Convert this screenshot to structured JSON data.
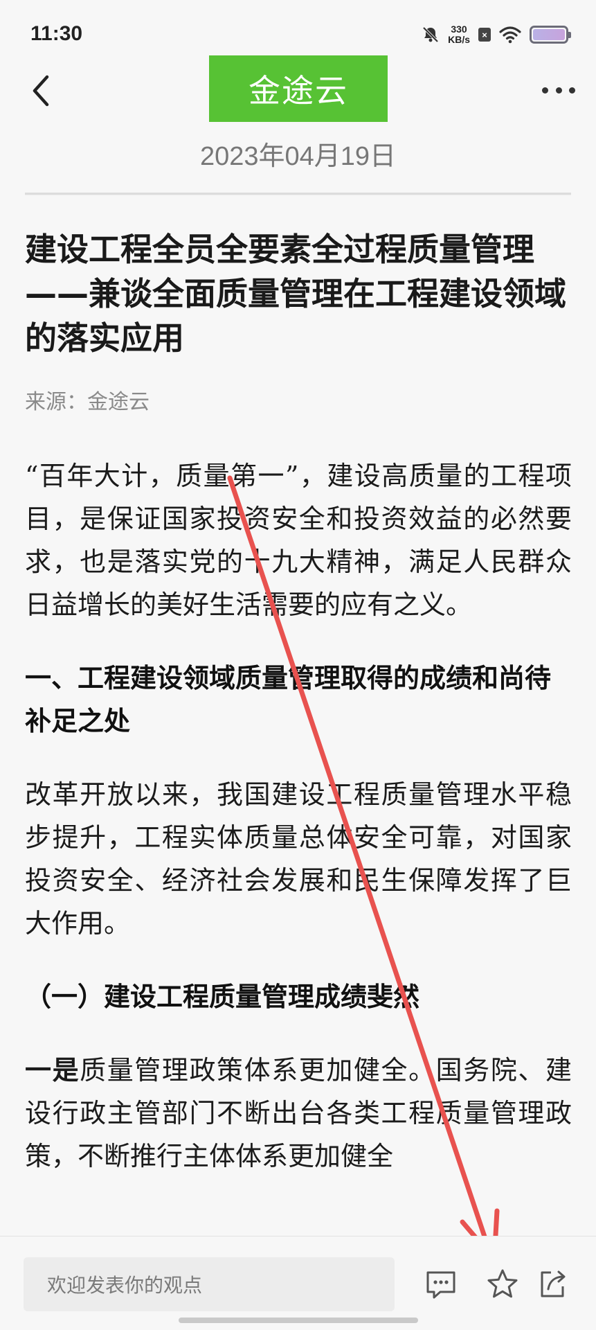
{
  "status_bar": {
    "time": "11:30",
    "net_speed_value": "330",
    "net_speed_unit": "KB/s",
    "icons": [
      "mute-bell-icon",
      "sim-x-icon",
      "wifi-icon",
      "battery-icon"
    ]
  },
  "header": {
    "logo_text": "金途云",
    "date": "2023年04月19日",
    "back_icon": "chevron-left-icon",
    "more_icon": "more-dots-icon"
  },
  "article": {
    "title": "建设工程全员全要素全过程质量管理——兼谈全面质量管理在工程建设领域的落实应用",
    "source": "来源：金途云",
    "intro": "“百年大计，质量第一”，建设高质量的工程项目，是保证国家投资安全和投资效益的必然要求，也是落实党的十九大精神，满足人民群众日益增长的美好生活需要的应有之义。",
    "heading1": "一、工程建设领域质量管理取得的成绩和尚待补足之处",
    "para2": "改革开放以来，我国建设工程质量管理水平稳步提升，工程实体质量总体安全可靠，对国家投资安全、经济社会发展和民生保障发挥了巨大作用。",
    "heading2": "（一）建设工程质量管理成绩斐然",
    "para3_lead": "一是",
    "para3_rest": "质量管理政策体系更加健全。国务院、建设行政主管部门不断出台各类工程质量管理政策，不断推行主体体系更加健全"
  },
  "bottom_bar": {
    "comment_placeholder": "欢迎发表你的观点",
    "icons": [
      "comment-icon",
      "star-icon",
      "share-icon"
    ]
  },
  "colors": {
    "brand_green": "#57c234",
    "annotation_arrow": "#e8524f"
  }
}
